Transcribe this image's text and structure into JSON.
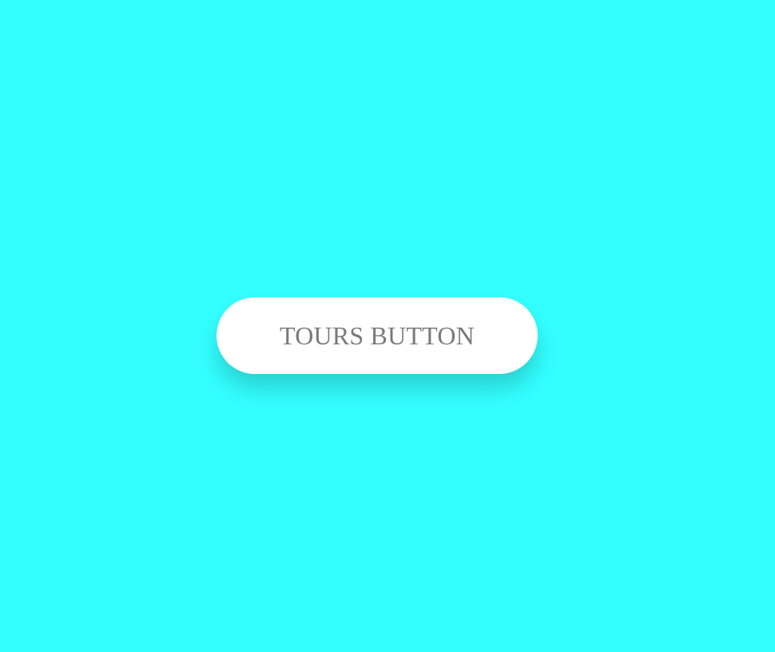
{
  "page": {
    "background_color": "#33ffff"
  },
  "button": {
    "label": "TOURS BUTTON",
    "background_color": "#ffffff",
    "text_color": "#7a7a7a"
  }
}
